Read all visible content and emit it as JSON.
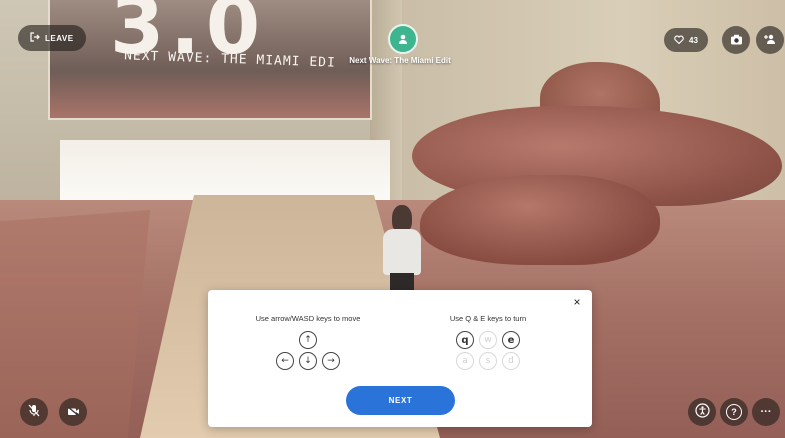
{
  "header": {
    "leave_label": "LEAVE",
    "likes_count": "43",
    "space_title": "Next Wave: The Miami Edit",
    "icons": {
      "leave": "exit-icon",
      "like": "heart-icon",
      "camera": "camera-icon",
      "share": "add-person-icon",
      "space": "space-avatar-icon"
    }
  },
  "scene": {
    "banner_digits": "3.0",
    "banner_text": "NEXT WAVE: THE MIAMI EDI"
  },
  "tutorial": {
    "move_hint": "Use arrow/WASD keys to move",
    "turn_hint": "Use Q & E keys to turn",
    "move_keys": {
      "up": "↑",
      "left": "←",
      "down": "↓",
      "right": "→"
    },
    "turn_keys": {
      "q": "q",
      "w": "w",
      "e": "e",
      "a": "a",
      "s": "s",
      "d": "d"
    },
    "next_label": "NEXT",
    "close_label": "×"
  },
  "footer": {
    "icons": [
      "mic-off-icon",
      "video-off-icon",
      "accessibility-icon",
      "help-icon",
      "more-icon"
    ],
    "help_glyph": "?",
    "more_glyph": "···"
  },
  "colors": {
    "accent": "#2a73d9",
    "badge": "#3fb58f",
    "hud_bg": "#231e1c"
  }
}
